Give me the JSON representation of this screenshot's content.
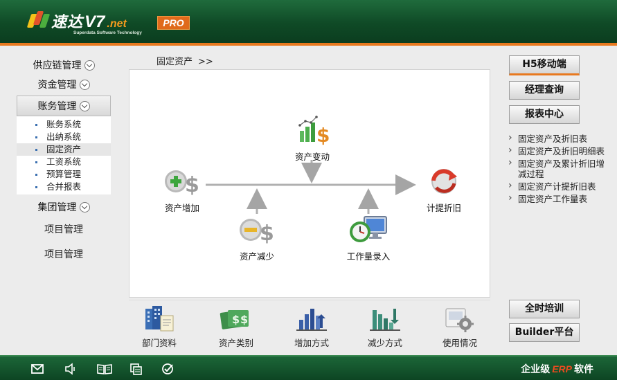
{
  "header": {
    "logo_cn": "速达",
    "logo_v7": "V7",
    "logo_net": ".net",
    "logo_sub": "Superdata Software Technology",
    "badge": "PRO"
  },
  "leftnav": {
    "groups": [
      {
        "label": "供应链管理"
      },
      {
        "label": "资金管理"
      },
      {
        "label": "账务管理"
      },
      {
        "label": "集团管理"
      }
    ],
    "subitems": [
      {
        "label": "账务系统"
      },
      {
        "label": "出纳系统"
      },
      {
        "label": "固定资产"
      },
      {
        "label": "工资系统"
      },
      {
        "label": "预算管理"
      },
      {
        "label": "合并报表"
      }
    ],
    "plain": [
      {
        "label": "项目管理"
      },
      {
        "label": "项目管理"
      }
    ]
  },
  "breadcrumb": {
    "current": "固定资产",
    "sep": ">>"
  },
  "flow": {
    "nodes": [
      {
        "label": "资产变动"
      },
      {
        "label": "资产增加"
      },
      {
        "label": "计提折旧"
      },
      {
        "label": "资产减少"
      },
      {
        "label": "工作量录入"
      }
    ]
  },
  "toolbar": {
    "items": [
      {
        "label": "部门资料"
      },
      {
        "label": "资产类别"
      },
      {
        "label": "增加方式"
      },
      {
        "label": "减少方式"
      },
      {
        "label": "使用情况"
      }
    ]
  },
  "right": {
    "buttons": [
      {
        "label": "H5移动端"
      },
      {
        "label": "经理查询"
      },
      {
        "label": "报表中心"
      },
      {
        "label": "全时培训"
      },
      {
        "label": "Builder平台"
      }
    ],
    "links": [
      {
        "label": "固定资产及折旧表"
      },
      {
        "label": "固定资产及折旧明细表"
      },
      {
        "label": "固定资产及累计折旧增减过程"
      },
      {
        "label": "固定资产计提折旧表"
      },
      {
        "label": "固定资产工作量表"
      }
    ]
  },
  "footer": {
    "brand_pre": "企业级",
    "brand_erp": "ERP",
    "brand_post": "软件",
    "icons": [
      "mail-icon",
      "speaker-icon",
      "book-icon",
      "copy-icon",
      "check-icon"
    ]
  },
  "colors": {
    "header_green": "#0f4a26",
    "accent_orange": "#e8791f",
    "footer_green": "#0d4523"
  }
}
